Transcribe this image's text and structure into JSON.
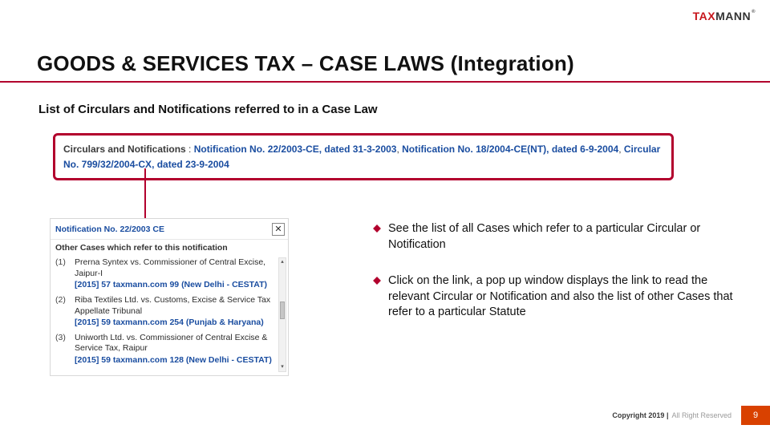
{
  "brand": {
    "part1": "TAX",
    "part2": "MANN",
    "reg": "®"
  },
  "headline": "GOODS & SERVICES TAX – CASE LAWS (Integration)",
  "subhead": "List of Circulars and Notifications referred to in a Case Law",
  "circ_box": {
    "label": "Circulars and Notifications",
    "sep": " : ",
    "links": [
      "Notification No. 22/2003-CE, dated 31-3-2003",
      "Notification No. 18/2004-CE(NT), dated 6-9-2004",
      "Circular No. 799/32/2004-CX, dated 23-9-2004"
    ],
    "joiner": ", "
  },
  "popup": {
    "title": "Notification No. 22/2003 CE",
    "close_glyph": "✕",
    "subtitle": "Other Cases which refer to this notification",
    "cases": [
      {
        "idx": "(1)",
        "name": "Prerna Syntex vs. Commissioner of Central Excise, Jaipur-I",
        "cite": "[2015] 57 taxmann.com 99 (New Delhi - CESTAT)"
      },
      {
        "idx": "(2)",
        "name": "Riba Textiles Ltd. vs. Customs, Excise & Service Tax Appellate Tribunal",
        "cite": "[2015] 59 taxmann.com 254 (Punjab & Haryana)"
      },
      {
        "idx": "(3)",
        "name": "Uniworth Ltd. vs. Commissioner of Central Excise & Service Tax, Raipur",
        "cite": "[2015] 59 taxmann.com 128 (New Delhi - CESTAT)"
      }
    ],
    "scroll": {
      "up": "▴",
      "down": "▾"
    }
  },
  "bullets": [
    "See the list of all Cases which refer to a particular Circular or Notification",
    "Click on the link, a pop up window displays the link to read the relevant Circular or Notification and also the list of other Cases that refer to a particular Statute"
  ],
  "footer": {
    "copyright": "Copyright 2019 |",
    "rights": " All Right Reserved",
    "page": "9"
  }
}
